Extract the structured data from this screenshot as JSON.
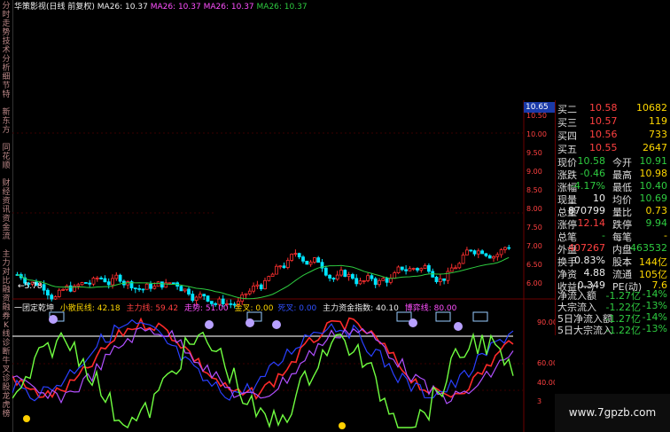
{
  "sidebar": {
    "tabs": [
      "分时走势",
      "技术分析",
      "细节特",
      "新东方",
      "同花顺",
      "财经资讯",
      "资金流",
      "主力对比",
      "融资融券",
      "K线诊断",
      "牛叉诊股",
      "龙虎榜"
    ]
  },
  "top_legend": {
    "name": "华策影视(日线 前复权)",
    "ma1": "MA26: 10.37",
    "ma2": "MA26: 10.37",
    "ma3": "MA26: 10.37",
    "ma4": "MA26: 10.37"
  },
  "price_marker": "10.65",
  "low_marker": "←5.78",
  "price_axis": [
    "10.50",
    "10.00",
    "9.50",
    "9.00",
    "8.50",
    "8.00",
    "7.50",
    "7.00",
    "6.50",
    "6.00"
  ],
  "indicator_legend": {
    "name": "一团定乾坤",
    "retail": "小散民线: 42.18",
    "main": "主力线: 59.42",
    "trend": "走势: 51.00",
    "golden": "金叉: 0.00",
    "dead": "死叉: 0.00",
    "fund_index": "主力资金指数: 40.10",
    "bull_line": "博弈线: 80.00"
  },
  "indicator_axis": [
    "90.00",
    "60.00",
    "40.00",
    "3"
  ],
  "quote_panel": {
    "rows": [
      {
        "label": "买二",
        "value": "10.58",
        "extra": "10682"
      },
      {
        "label": "买三",
        "value": "10.57",
        "extra": "119"
      },
      {
        "label": "买四",
        "value": "10.56",
        "extra": "733"
      },
      {
        "label": "买五",
        "value": "10.55",
        "extra": "2647"
      }
    ],
    "stats": [
      {
        "l1": "现价",
        "v1": "10.58",
        "l2": "今开",
        "v2": "10.91"
      },
      {
        "l1": "涨跌",
        "v1": "-0.46",
        "l2": "最高",
        "v2": "10.98"
      },
      {
        "l1": "涨幅",
        "v1": "-4.17%",
        "l2": "最低",
        "v2": "10.40"
      },
      {
        "l1": "现量",
        "v1": "10",
        "l2": "均价",
        "v2": "10.69"
      },
      {
        "l1": "总量",
        "v1": "870799",
        "l2": "量比",
        "v2": "0.73"
      },
      {
        "l1": "涨停",
        "v1": "12.14",
        "l2": "跌停",
        "v2": "9.94"
      },
      {
        "l1": "总笔",
        "v1": "-",
        "l2": "每笔",
        "v2": "-"
      },
      {
        "l1": "外盘",
        "v1": "407267",
        "l2": "内盘",
        "v2": "463532"
      },
      {
        "l1": "换手",
        "v1": "0.83%",
        "l2": "股本",
        "v2": "144亿"
      },
      {
        "l1": "净资",
        "v1": "4.88",
        "l2": "流通",
        "v2": "105亿"
      },
      {
        "l1": "收益(一)",
        "v1": "0.349",
        "l2": "PE(动)",
        "v2": "7.6"
      }
    ],
    "flows": [
      {
        "label": "净流入额",
        "value": "-1.27亿",
        "pct": "-14%"
      },
      {
        "label": "大宗流入",
        "value": "-1.22亿",
        "pct": "-13%"
      },
      {
        "label": "5日净流入额",
        "value": "-1.27亿",
        "pct": "-14%"
      },
      {
        "label": "5日大宗流入",
        "value": "-1.22亿",
        "pct": "-13%"
      }
    ]
  },
  "watermark": "www.7gpzb.com",
  "colors": {
    "up": "#ff3030",
    "down": "#00e5ff",
    "ma": "#2ecc40",
    "retail": "#ff3030",
    "main": "#3050ff",
    "fund": "#70ff40",
    "purple": "#b050ff"
  }
}
